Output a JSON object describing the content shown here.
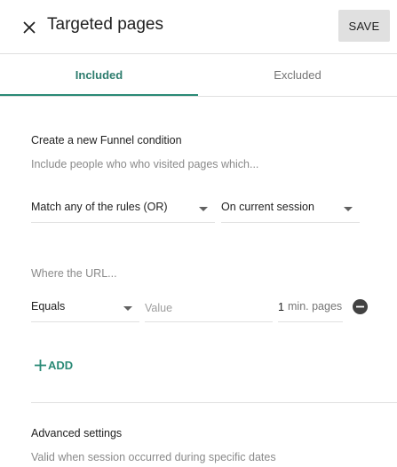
{
  "header": {
    "title": "Targeted pages",
    "save_label": "SAVE"
  },
  "tabs": [
    {
      "label": "Included",
      "active": true
    },
    {
      "label": "Excluded",
      "active": false
    }
  ],
  "condition": {
    "heading": "Create a new Funnel condition",
    "subtext": "Include people who who visited pages which...",
    "match_select": "Match any of the rules (OR)",
    "session_select": "On current session"
  },
  "url_rule": {
    "label": "Where the URL...",
    "operator": "Equals",
    "value_placeholder": "Value",
    "pages_value": "1",
    "pages_unit": "min. pages"
  },
  "add_label": "ADD",
  "advanced": {
    "heading": "Advanced settings",
    "subtext": "Valid when session occurred during specific dates"
  },
  "colors": {
    "accent": "#2a8a76",
    "save_bg": "#e0e0e0",
    "divider": "#e0e0e0"
  },
  "icons": {
    "close": "close-icon",
    "caret": "caret-down-icon",
    "remove": "remove-circle-icon",
    "add": "plus-icon"
  }
}
